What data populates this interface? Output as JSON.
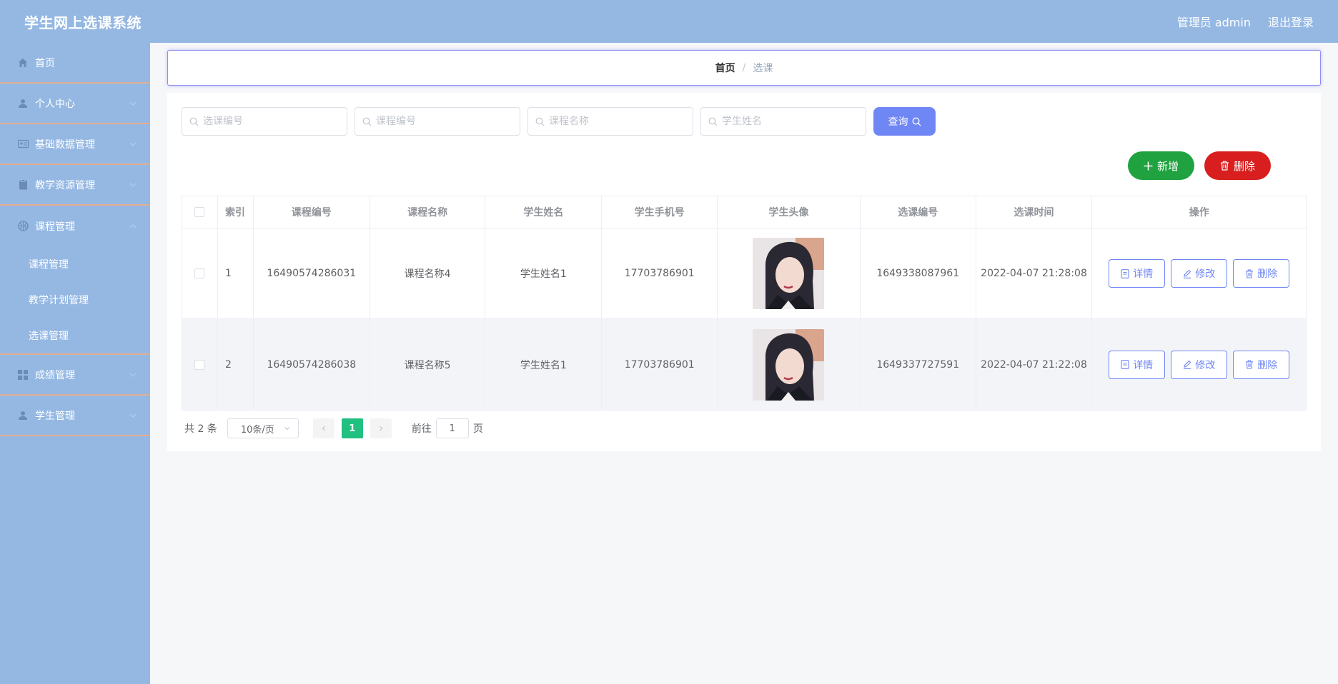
{
  "app": {
    "title": "学生网上选课系统"
  },
  "header": {
    "user_label": "管理员 admin",
    "logout_label": "退出登录"
  },
  "sidebar": {
    "items": [
      {
        "label": "首页",
        "icon": "home-icon"
      },
      {
        "label": "个人中心",
        "icon": "user-icon"
      },
      {
        "label": "基础数据管理",
        "icon": "id-card-icon"
      },
      {
        "label": "教学资源管理",
        "icon": "clipboard-icon"
      },
      {
        "label": "课程管理",
        "icon": "basketball-icon"
      },
      {
        "label": "成绩管理",
        "icon": "grid-icon"
      },
      {
        "label": "学生管理",
        "icon": "user-icon"
      }
    ],
    "sub_items": [
      "课程管理",
      "教学计划管理",
      "选课管理"
    ]
  },
  "breadcrumb": {
    "home": "首页",
    "separator": "/",
    "current": "选课"
  },
  "search": {
    "placeholders": [
      "选课编号",
      "课程编号",
      "课程名称",
      "学生姓名"
    ],
    "query_label": "查询"
  },
  "actions": {
    "add_label": "新增",
    "delete_label": "删除"
  },
  "table": {
    "headers": [
      "索引",
      "课程编号",
      "课程名称",
      "学生姓名",
      "学生手机号",
      "学生头像",
      "选课编号",
      "选课时间",
      "操作"
    ],
    "rows": [
      {
        "index": "1",
        "course_code": "16490574286031",
        "course_name": "课程名称4",
        "student_name": "学生姓名1",
        "phone": "17703786901",
        "selection_code": "1649338087961",
        "time": "2022-04-07 21:28:08"
      },
      {
        "index": "2",
        "course_code": "16490574286038",
        "course_name": "课程名称5",
        "student_name": "学生姓名1",
        "phone": "17703786901",
        "selection_code": "1649337727591",
        "time": "2022-04-07 21:22:08"
      }
    ],
    "op_labels": {
      "detail": "详情",
      "edit": "修改",
      "delete": "删除"
    }
  },
  "pagination": {
    "total_text": "共 2 条",
    "page_size": "10条/页",
    "current_page": "1",
    "goto_prefix": "前往",
    "goto_value": "1",
    "goto_suffix": "页"
  },
  "colors": {
    "theme": "#95b8e3",
    "primary": "#6f86f5",
    "success": "#1fa23f",
    "danger": "#d81e1e",
    "page_active": "#20c080",
    "divider": "#e3ad90"
  }
}
